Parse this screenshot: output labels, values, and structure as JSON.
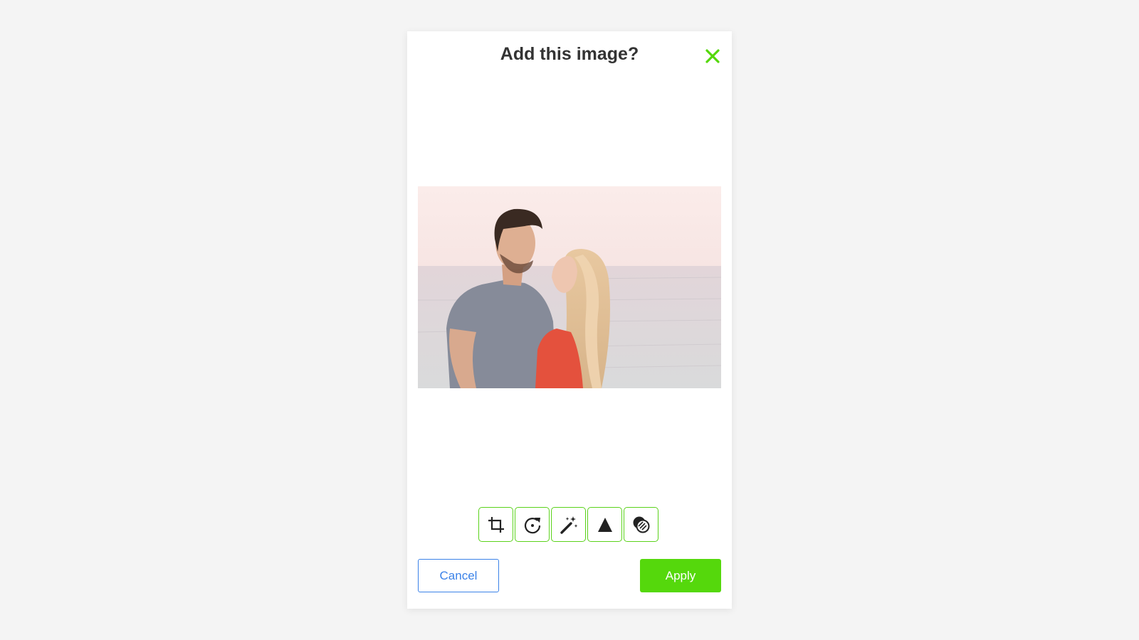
{
  "dialog": {
    "title": "Add this image?",
    "close_icon": "close-icon",
    "accent_color": "#55d80c",
    "cancel_label": "Cancel",
    "apply_label": "Apply",
    "cancel_color": "#3b82e8"
  },
  "toolbar": {
    "tools": [
      {
        "name": "crop",
        "icon": "crop-icon"
      },
      {
        "name": "rotate",
        "icon": "rotate-icon"
      },
      {
        "name": "enhance",
        "icon": "magic-wand-icon"
      },
      {
        "name": "sharpen",
        "icon": "triangle-icon"
      },
      {
        "name": "filter",
        "icon": "filter-icon"
      }
    ]
  },
  "image": {
    "description_icon": "photo"
  }
}
